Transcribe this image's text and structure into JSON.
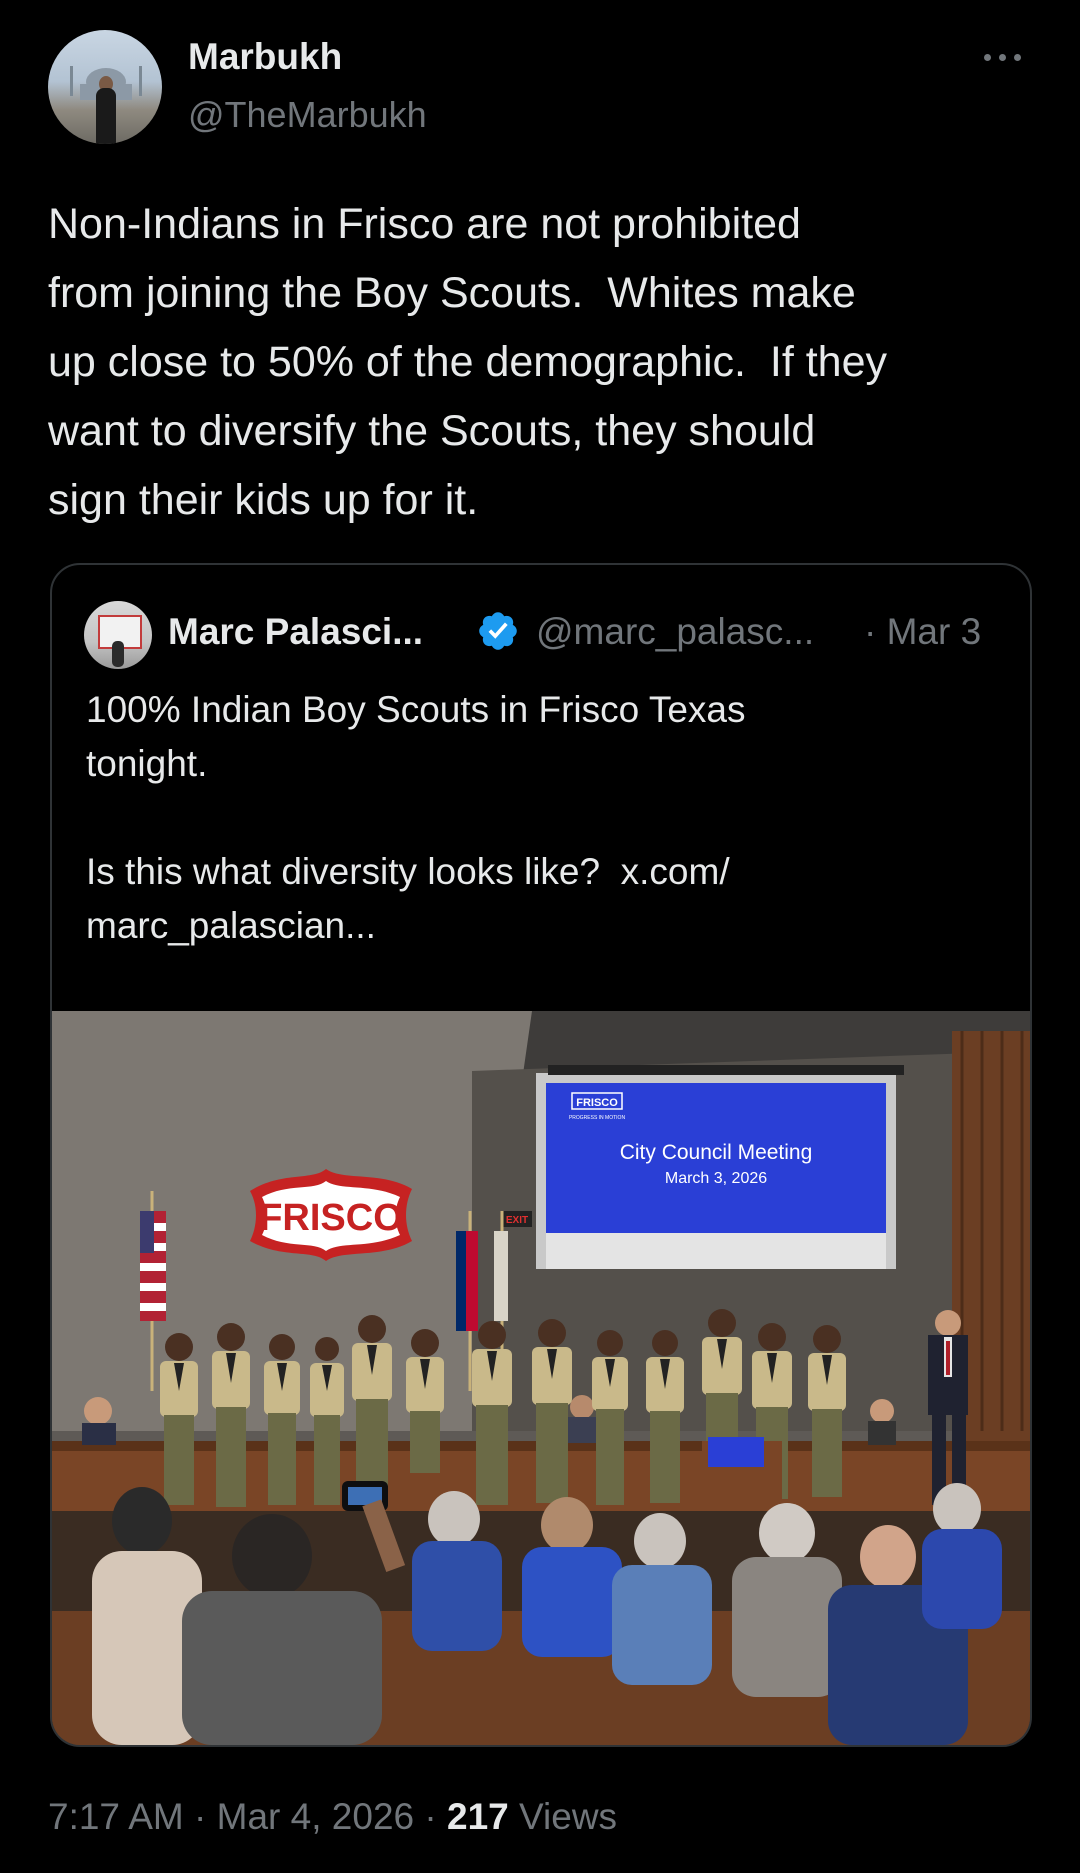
{
  "author": {
    "display_name": "Marbukh",
    "handle": "@TheMarbukh"
  },
  "tweet": {
    "text": "Non-Indians in Frisco are not prohibited\nfrom joining the Boy Scouts.  Whites make\nup close to 50% of the demographic.  If they\nwant to diversify the Scouts, they should\nsign their kids up for it."
  },
  "quoted": {
    "display_name": "Marc Palasci...",
    "handle": "@marc_palasc...",
    "date": "· Mar 3",
    "text": "100% Indian Boy Scouts in Frisco Texas\ntonight.\n\nIs this what diversity looks like?  x.com/\nmarc_palascian...",
    "verified_color": "#1d9bf0",
    "photo": {
      "frisco_sign": "FRISCO",
      "slide_logo": "FRISCO",
      "slide_tagline": "PROGRESS IN MOTION",
      "slide_title": "City Council Meeting",
      "slide_date": "March 3, 2026",
      "exit_sign": "EXIT"
    }
  },
  "footer": {
    "time": "7:17 AM",
    "sep1": " · ",
    "date": "Mar 4, 2026",
    "sep2": " · ",
    "views_count": "217",
    "views_label": " Views"
  },
  "colors": {
    "background": "#000000",
    "text": "#e7e9ea",
    "secondary": "#71767b",
    "border": "#2f3336",
    "slide_blue": "#2a3fd6",
    "sign_red": "#c62222"
  }
}
